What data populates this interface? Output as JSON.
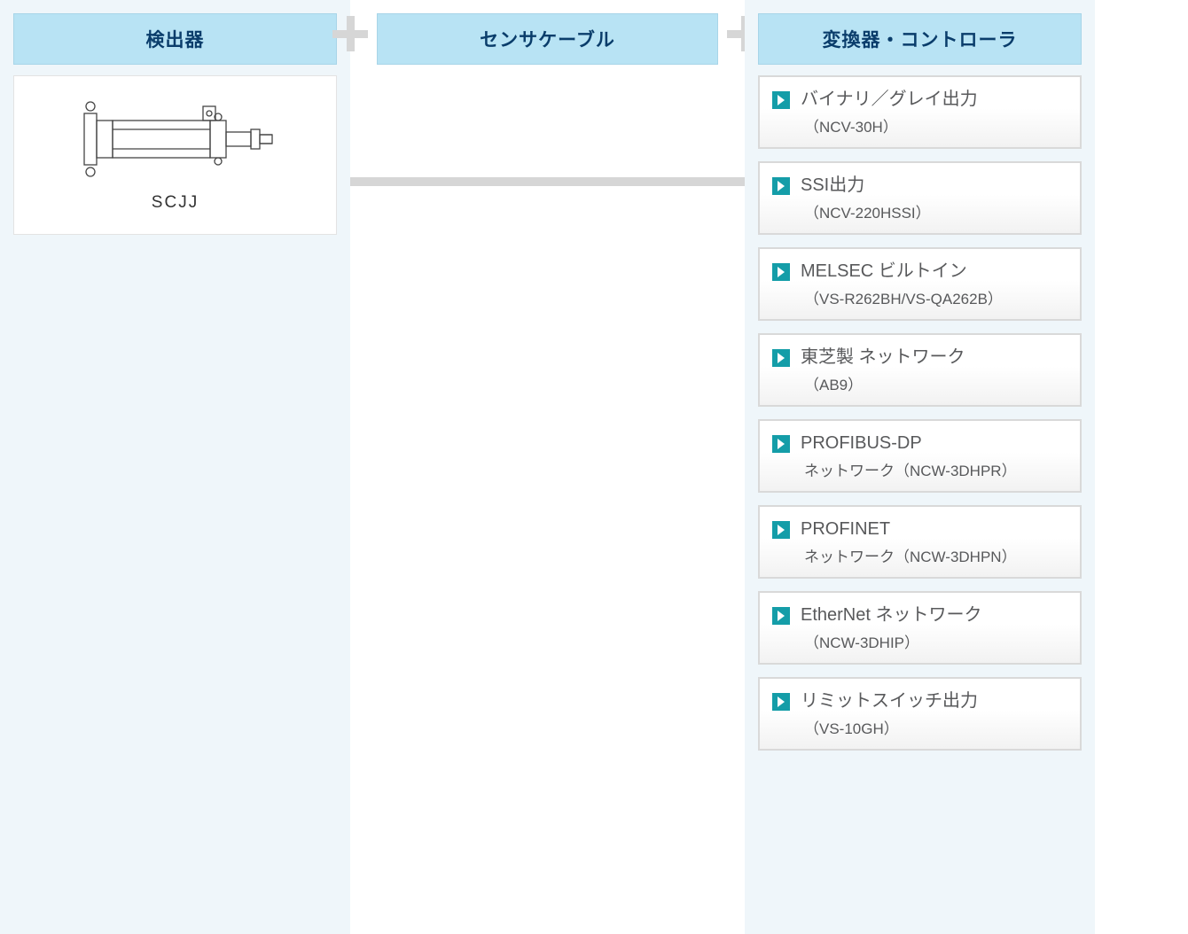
{
  "columns": {
    "detector": {
      "title": "検出器",
      "product_label": "SCJJ"
    },
    "sensor_cable": {
      "title": "センサケーブル"
    },
    "controller": {
      "title": "変換器・コントローラ",
      "items": [
        {
          "title": "バイナリ／グレイ出力",
          "sub": "（NCV-30H）"
        },
        {
          "title": "SSI出力",
          "sub": "（NCV-220HSSI）"
        },
        {
          "title": "MELSEC ビルトイン",
          "sub": "（VS-R262BH/VS-QA262B）"
        },
        {
          "title": "東芝製 ネットワーク",
          "sub": "（AB9）"
        },
        {
          "title": "PROFIBUS-DP",
          "sub": "ネットワーク（NCW-3DHPR）"
        },
        {
          "title": "PROFINET",
          "sub": "ネットワーク（NCW-3DHPN）"
        },
        {
          "title": "EtherNet ネットワーク",
          "sub": "（NCW-3DHIP）"
        },
        {
          "title": "リミットスイッチ出力",
          "sub": "（VS-10GH）"
        }
      ]
    }
  }
}
